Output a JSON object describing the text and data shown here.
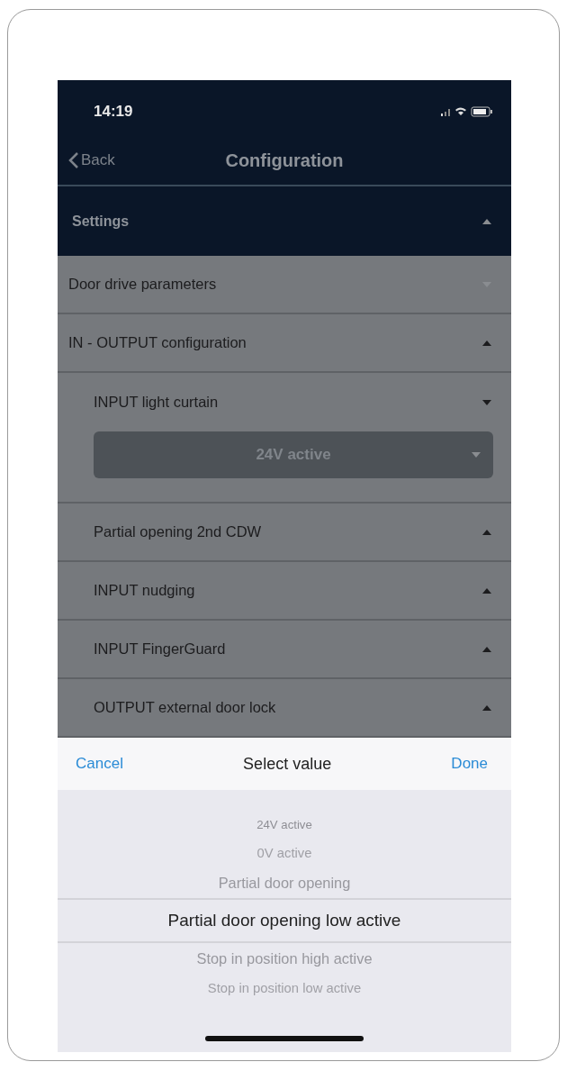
{
  "status_bar": {
    "time": "14:19"
  },
  "nav": {
    "back": "Back",
    "title": "Configuration"
  },
  "section": {
    "title": "Settings",
    "expanded": true
  },
  "groups": [
    {
      "label": "Door drive parameters",
      "expanded": false,
      "disabled": true
    },
    {
      "label": "IN - OUTPUT configuration",
      "expanded": true,
      "disabled": false,
      "children": [
        {
          "label": "INPUT light curtain",
          "expanded": false,
          "value": "24V active"
        },
        {
          "label": "Partial opening 2nd CDW",
          "expanded": true
        },
        {
          "label": "INPUT nudging",
          "expanded": true
        },
        {
          "label": "INPUT FingerGuard",
          "expanded": true
        },
        {
          "label": "OUTPUT external door lock",
          "expanded": true
        }
      ]
    }
  ],
  "picker": {
    "cancel": "Cancel",
    "title": "Select value",
    "done": "Done",
    "options": [
      {
        "label": "24V active",
        "selected": false
      },
      {
        "label": "0V active",
        "selected": false
      },
      {
        "label": "Partial door opening",
        "selected": false
      },
      {
        "label": "Partial door opening low active",
        "selected": true
      },
      {
        "label": "Stop in position high active",
        "selected": false
      },
      {
        "label": "Stop in position low active",
        "selected": false
      }
    ]
  }
}
